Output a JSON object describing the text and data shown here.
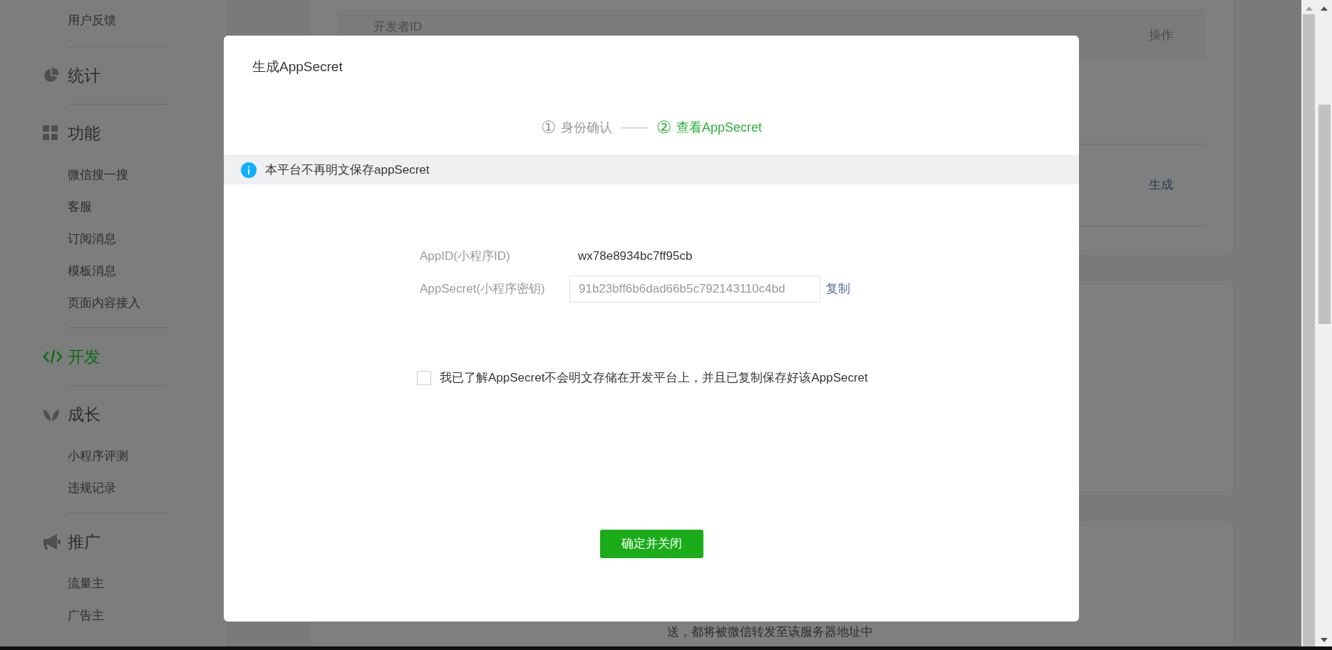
{
  "sidebar": {
    "groups": [
      {
        "items": [
          {
            "label": "用户反馈",
            "selected": false
          }
        ]
      },
      {
        "title": "统计",
        "selected": false
      },
      {
        "title": "功能",
        "selected": false,
        "items": [
          {
            "label": "微信搜一搜",
            "selected": false
          },
          {
            "label": "客服",
            "selected": false
          },
          {
            "label": "订阅消息",
            "selected": false
          },
          {
            "label": "模板消息",
            "selected": false
          },
          {
            "label": "页面内容接入",
            "selected": false
          }
        ]
      },
      {
        "title": "开发",
        "selected": true
      },
      {
        "title": "成长",
        "selected": false,
        "items": [
          {
            "label": "小程序评测",
            "selected": false
          },
          {
            "label": "违规记录",
            "selected": false
          }
        ]
      },
      {
        "title": "推广",
        "selected": false,
        "items": [
          {
            "label": "流量主",
            "selected": false
          },
          {
            "label": "广告主",
            "selected": false
          }
        ]
      }
    ]
  },
  "background": {
    "table": {
      "columns": [
        "开发者ID",
        "操作"
      ],
      "rows": [
        {
          "action": "生成"
        }
      ]
    },
    "footer_text": "送，都将被微信转发至该服务器地址中"
  },
  "modal": {
    "title": "生成AppSecret",
    "steps": [
      {
        "number": "①",
        "label": "身份确认",
        "selected": false
      },
      {
        "number": "②",
        "label": "查看AppSecret",
        "selected": true
      }
    ],
    "notice": "本平台不再明文保存appSecret",
    "fields": [
      {
        "kind": "text",
        "label": "AppID(小程序ID)",
        "value": "wx78e8934bc7ff95cb"
      },
      {
        "kind": "input",
        "label": "AppSecret(小程序密钥)",
        "value": "91b23bff6b6dad66b5c792143110c4bd",
        "action": "复制"
      }
    ],
    "checkbox": {
      "label": "我已了解AppSecret不会明文存储在开发平台上，并且已复制保存好该AppSecret",
      "checked": false
    },
    "confirm_button": "确定并关闭"
  }
}
